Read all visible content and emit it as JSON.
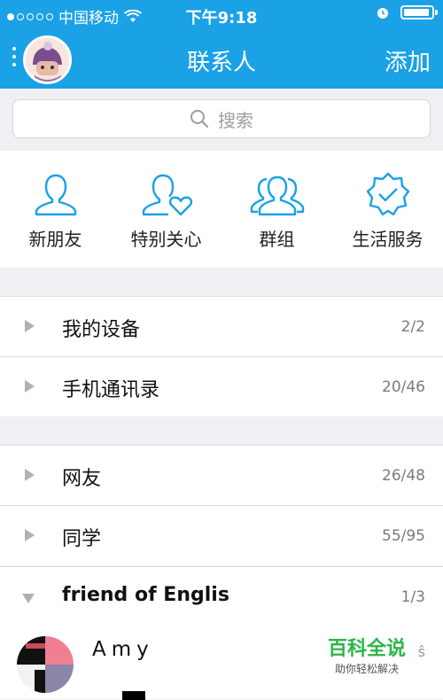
{
  "status_bar": {
    "carrier": "中国移动",
    "time": "下午9:18",
    "signal_dots": 5,
    "signal_filled": 1
  },
  "nav": {
    "title": "联系人",
    "add_label": "添加"
  },
  "search": {
    "placeholder": "搜索"
  },
  "quick_actions": [
    {
      "label": "新朋友",
      "icon": "person-icon"
    },
    {
      "label": "特别关心",
      "icon": "person-heart-icon"
    },
    {
      "label": "群组",
      "icon": "group-icon"
    },
    {
      "label": "生活服务",
      "icon": "badge-check-icon"
    }
  ],
  "groups": [
    {
      "name": "我的设备",
      "count": "2/2"
    },
    {
      "name": "手机通讯录",
      "count": "20/46"
    },
    {
      "name": "网友",
      "count": "26/48"
    },
    {
      "name": "同学",
      "count": "55/95"
    },
    {
      "name": "friend of Englis",
      "count": "1/3"
    }
  ],
  "friend": {
    "name": "Amy",
    "tail": "ŝ"
  },
  "watermark": {
    "main": "百科全说",
    "sub": "助你轻松解决"
  },
  "colors": {
    "accent": "#1aa1e6",
    "icon": "#1aa1e6"
  }
}
